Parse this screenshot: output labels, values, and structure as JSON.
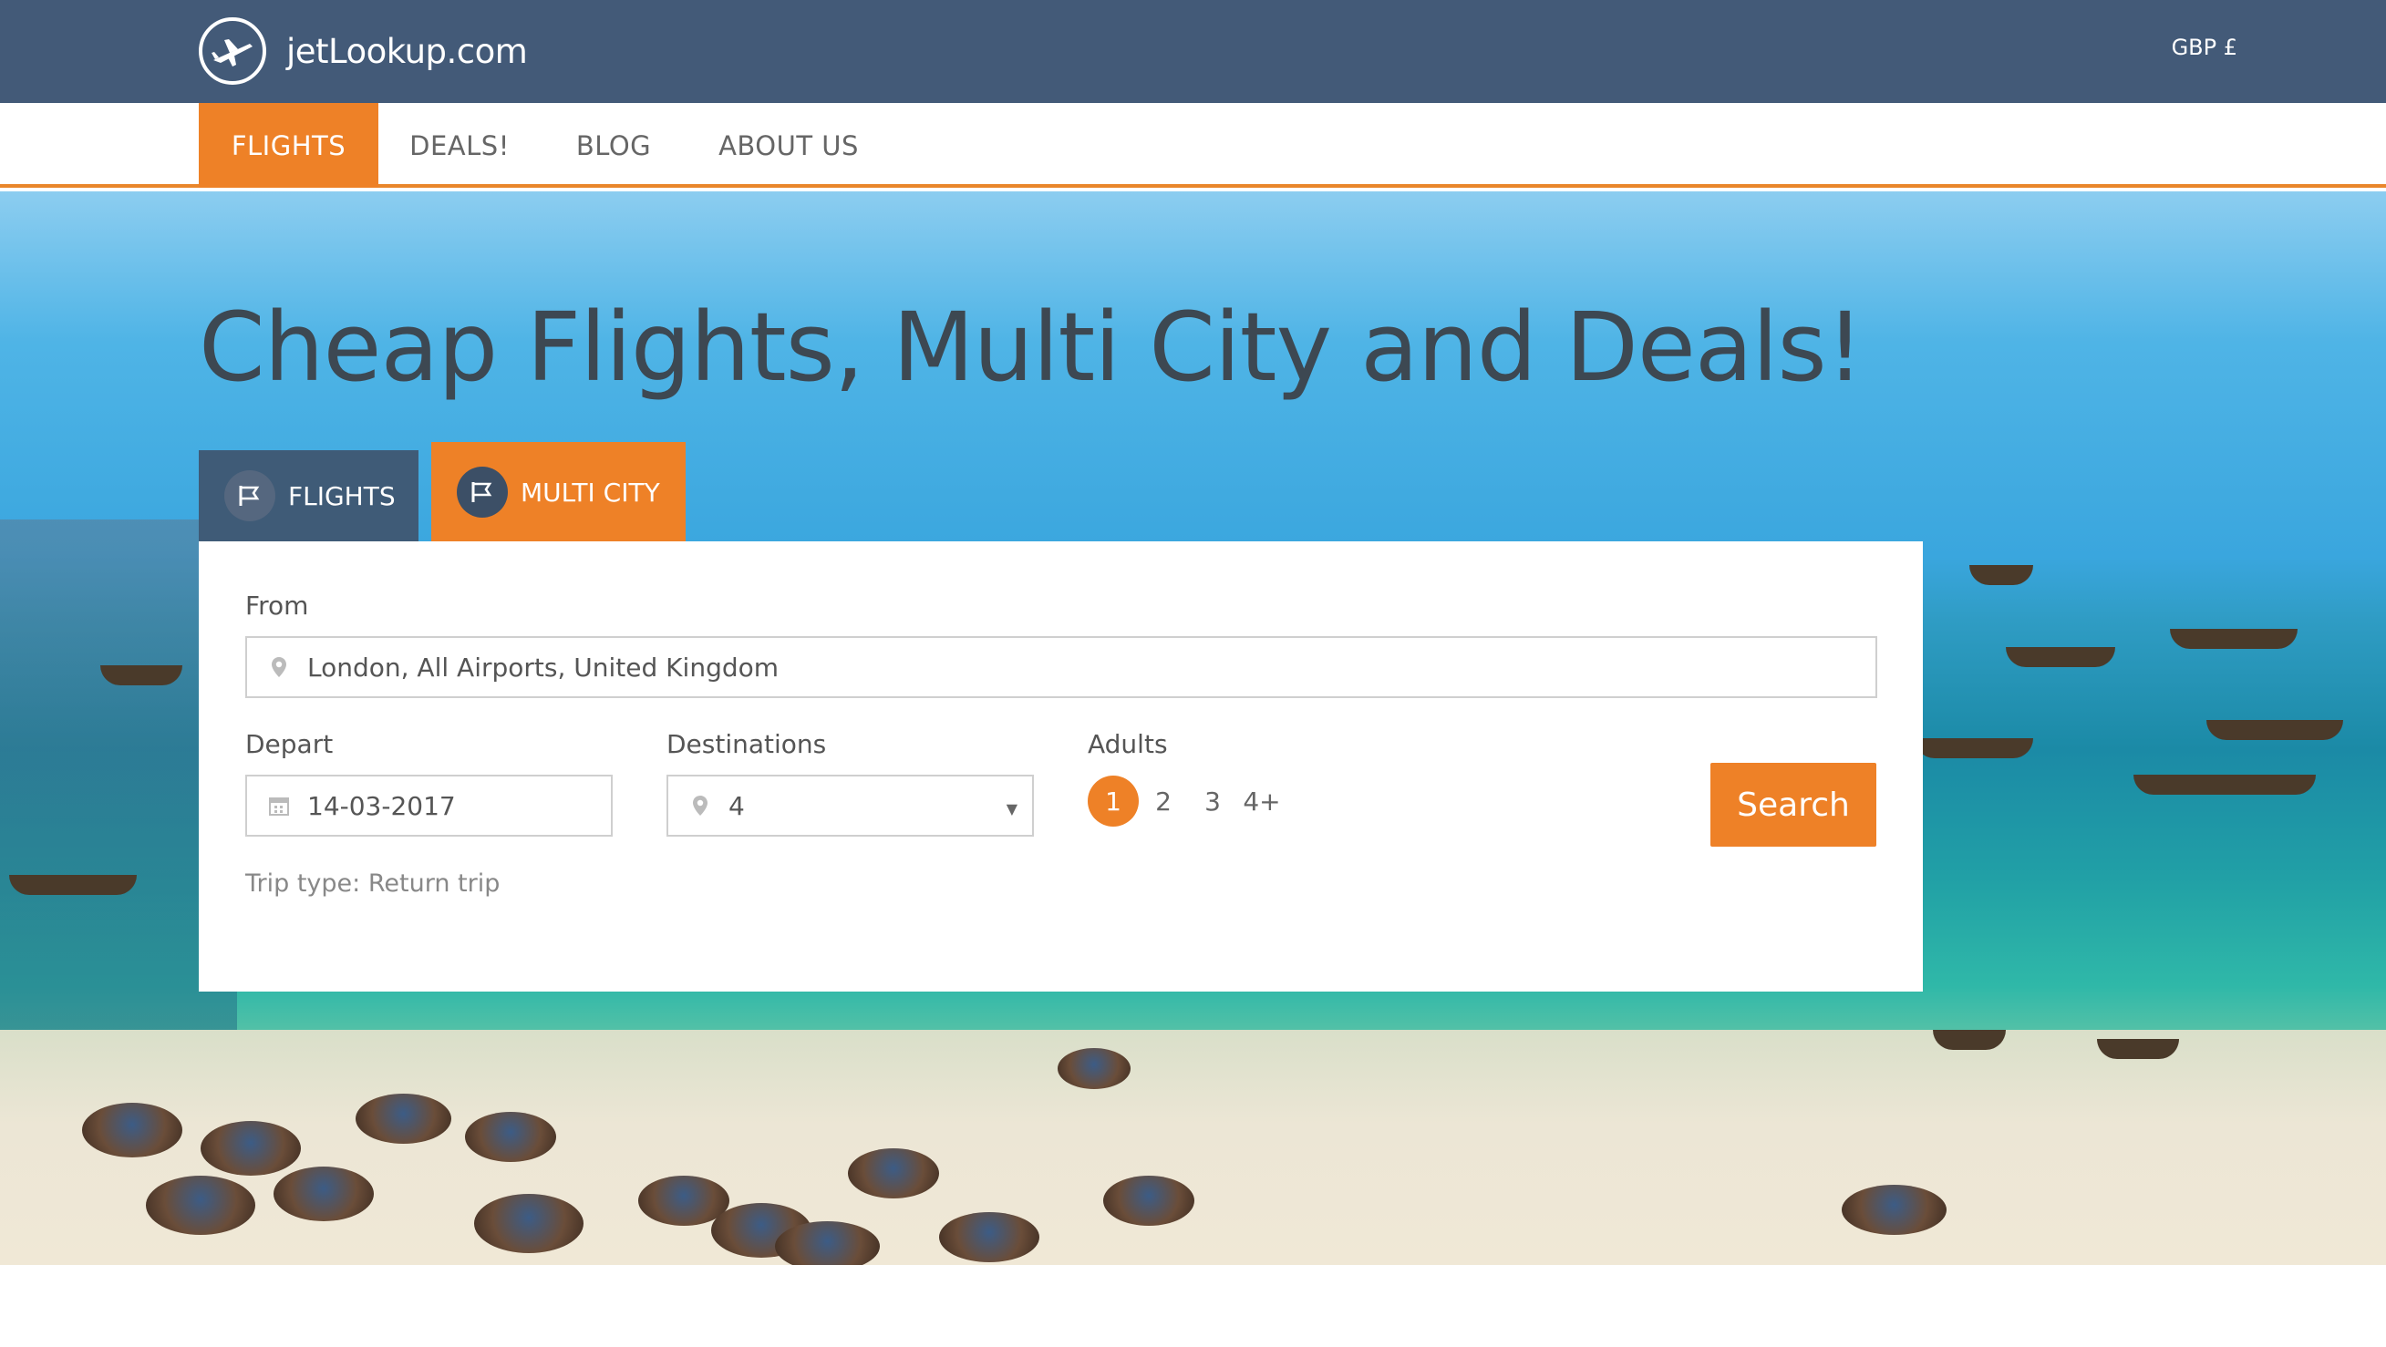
{
  "header": {
    "logo_text": "jetLookup.com",
    "currency": "GBP £"
  },
  "nav": {
    "items": [
      {
        "label": "FLIGHTS",
        "active": true
      },
      {
        "label": "DEALS!",
        "active": false
      },
      {
        "label": "BLOG",
        "active": false
      },
      {
        "label": "ABOUT US",
        "active": false
      }
    ]
  },
  "hero": {
    "headline": "Cheap Flights, Multi City and Deals!"
  },
  "search_tabs": [
    {
      "label": "FLIGHTS",
      "icon": "flag-icon",
      "active": false
    },
    {
      "label": "MULTI CITY",
      "icon": "flag-icon",
      "active": true
    }
  ],
  "search": {
    "from_label": "From",
    "from_value": "London, All Airports, United Kingdom",
    "depart_label": "Depart",
    "depart_value": "14-03-2017",
    "destinations_label": "Destinations",
    "destinations_value": "4",
    "adults_label": "Adults",
    "adults_options": [
      "1",
      "2",
      "3",
      "4+"
    ],
    "adults_selected": "1",
    "search_button": "Search",
    "trip_type": "Trip type: Return trip"
  },
  "colors": {
    "header_bg": "#435a78",
    "accent": "#ee8127",
    "tab_inactive": "#3f5b77"
  }
}
